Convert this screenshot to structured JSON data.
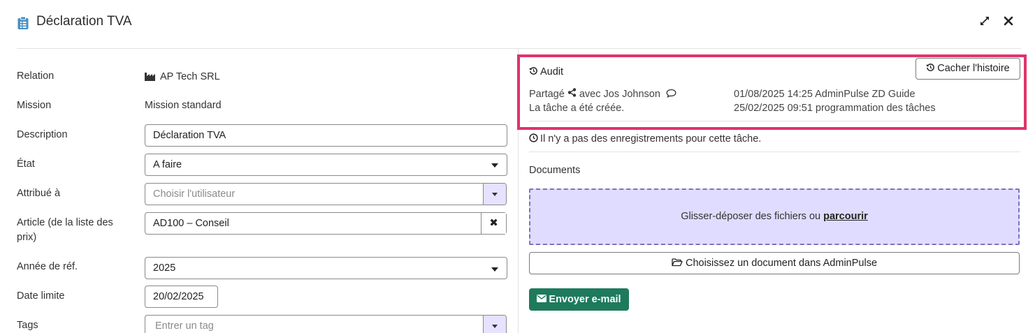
{
  "header": {
    "title": "Déclaration TVA",
    "icon": "clipboard-list-icon"
  },
  "form": {
    "relation": {
      "label": "Relation",
      "value": "AP Tech SRL"
    },
    "mission": {
      "label": "Mission",
      "value": "Mission standard"
    },
    "description": {
      "label": "Description",
      "value": "Déclaration TVA"
    },
    "state": {
      "label": "État",
      "value": "A faire"
    },
    "assigned": {
      "label": "Attribué à",
      "placeholder": "Choisir l'utilisateur"
    },
    "article": {
      "label": "Article (de la liste des prix)",
      "value": "AD100 – Conseil"
    },
    "year": {
      "label": "Année de réf.",
      "value": "2025"
    },
    "deadline": {
      "label": "Date limite",
      "value": "20/02/2025"
    },
    "tags": {
      "label": "Tags",
      "placeholder": "Entrer un tag"
    }
  },
  "audit": {
    "title": "Audit",
    "hide_button": "Cacher l'histoire",
    "entries": [
      {
        "pre": "Partagé",
        "post": "avec Jos Johnson",
        "date": "01/08/2025 14:25 AdminPulse ZD Guide"
      },
      {
        "pre": "La tâche a été créée.",
        "post": "",
        "date": "25/02/2025 09:51 programmation des tâches"
      }
    ]
  },
  "records": {
    "empty_text": "Il n'y a pas des enregistrements pour cette tâche."
  },
  "documents": {
    "label": "Documents",
    "dropzone_text": "Glisser-déposer des fichiers ou ",
    "browse_link": "parcourir",
    "choose_button": "Choisissez un document dans AdminPulse"
  },
  "email_button": "Envoyer e-mail",
  "colors": {
    "accent_purple": "#e0dcff",
    "highlight_border": "#e0336a",
    "email_green": "#1e7a5c",
    "title_icon_blue": "#4a90c2"
  }
}
